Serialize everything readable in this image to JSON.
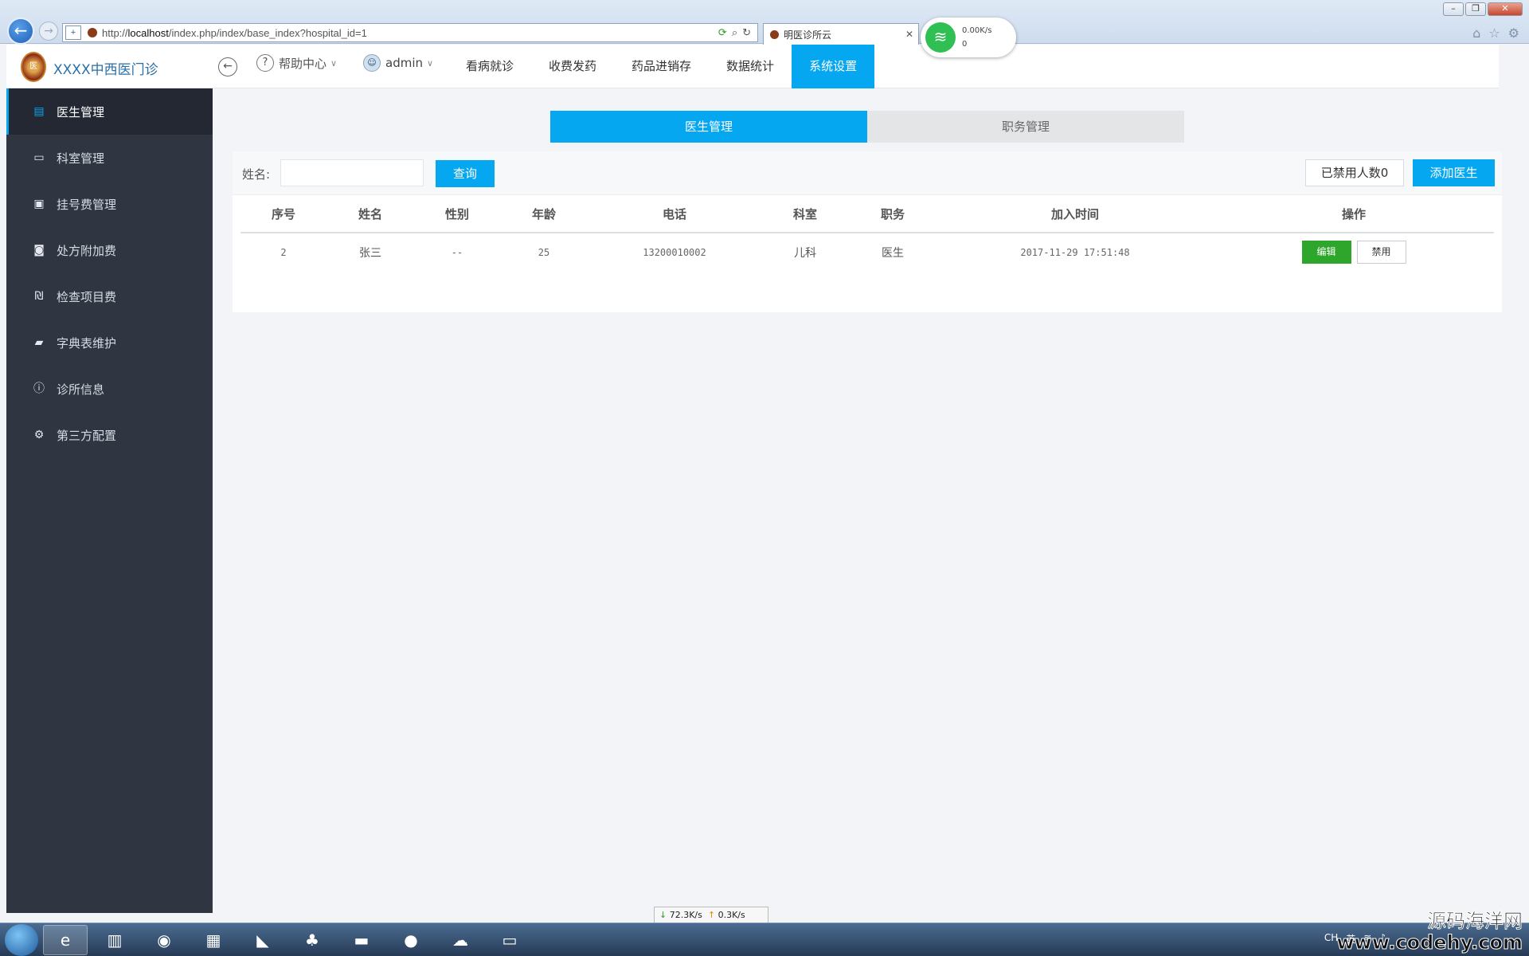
{
  "browser": {
    "url_prefix": "http://",
    "url_host": "localhost",
    "url_path": "/index.php/index/base_index?hospital_id=1",
    "tab_title": "明医诊所云",
    "net_speed": "0.00K/s",
    "net_count": "0"
  },
  "header": {
    "brand": "XXXX中西医门诊",
    "help": "帮助中心",
    "user": "admin",
    "nav": [
      "看病就诊",
      "收费发药",
      "药品进销存",
      "数据统计",
      "系统设置"
    ]
  },
  "sidebar": {
    "items": [
      {
        "label": "医生管理",
        "icon": "doctor-icon"
      },
      {
        "label": "科室管理",
        "icon": "id-card-icon"
      },
      {
        "label": "挂号费管理",
        "icon": "ticket-icon"
      },
      {
        "label": "处方附加费",
        "icon": "money-icon"
      },
      {
        "label": "检查项目费",
        "icon": "shekel-icon"
      },
      {
        "label": "字典表维护",
        "icon": "book-icon"
      },
      {
        "label": "诊所信息",
        "icon": "info-icon"
      },
      {
        "label": "第三方配置",
        "icon": "gear-icon"
      }
    ]
  },
  "tabs": [
    "医生管理",
    "职务管理"
  ],
  "search": {
    "label": "姓名:",
    "value": "",
    "query_button": "查询",
    "disabled_button": "已禁用人数0",
    "add_button": "添加医生"
  },
  "table": {
    "columns": [
      "序号",
      "姓名",
      "性别",
      "年龄",
      "电话",
      "科室",
      "职务",
      "加入时间",
      "操作"
    ],
    "rows": [
      {
        "index": "2",
        "name": "张三",
        "gender": "--",
        "age": "25",
        "phone": "13200010002",
        "dept": "儿科",
        "role": "医生",
        "joined": "2017-11-29 17:51:48",
        "edit": "编辑",
        "disable": "禁用"
      }
    ]
  },
  "taskbar": {
    "download": "72.3K/s",
    "upload": "0.3K/s",
    "tray_lang": "CH",
    "tray_ime": "英"
  },
  "watermark": {
    "cn": "源码海洋网",
    "en": "www.codehy.com"
  },
  "colors": {
    "accent": "#05a7f1",
    "sidebar": "#2f3541",
    "success": "#2ea62b"
  }
}
